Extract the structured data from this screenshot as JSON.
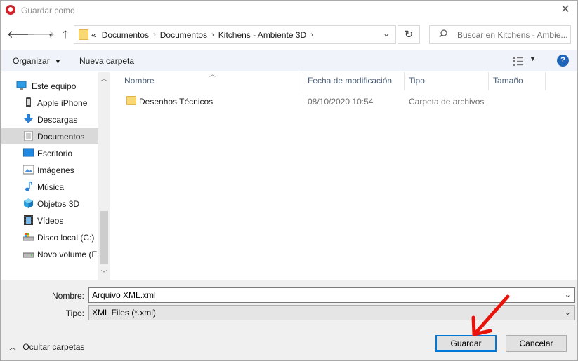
{
  "window": {
    "title": "Guardar como"
  },
  "addressbar": {
    "overflow": "«",
    "crumbs": [
      "Documentos",
      "Documentos",
      "Kitchens - Ambiente 3D"
    ],
    "search_placeholder": "Buscar en Kitchens - Ambie..."
  },
  "toolbar": {
    "organize": "Organizar",
    "new_folder": "Nueva carpeta"
  },
  "nav": {
    "items": [
      {
        "label": "Este equipo",
        "icon": "computer-icon"
      },
      {
        "label": "Apple iPhone",
        "icon": "phone-icon"
      },
      {
        "label": "Descargas",
        "icon": "download-icon"
      },
      {
        "label": "Documentos",
        "icon": "documents-icon",
        "selected": true
      },
      {
        "label": "Escritorio",
        "icon": "desktop-icon"
      },
      {
        "label": "Imágenes",
        "icon": "pictures-icon"
      },
      {
        "label": "Música",
        "icon": "music-icon"
      },
      {
        "label": "Objetos 3D",
        "icon": "3d-objects-icon"
      },
      {
        "label": "Vídeos",
        "icon": "videos-icon"
      },
      {
        "label": "Disco local (C:)",
        "icon": "local-disk-icon"
      },
      {
        "label": "Novo volume (E",
        "icon": "drive-icon"
      }
    ]
  },
  "list": {
    "columns": [
      "Nombre",
      "Fecha de modificación",
      "Tipo",
      "Tamaño"
    ],
    "rows": [
      {
        "name": "Desenhos Técnicos",
        "date": "08/10/2020 10:54",
        "type": "Carpeta de archivos",
        "size": ""
      }
    ]
  },
  "form": {
    "name_label": "Nombre:",
    "name_value": "Arquivo XML.xml",
    "type_label": "Tipo:",
    "type_value": "XML Files (*.xml)"
  },
  "footer": {
    "hide_folders": "Ocultar carpetas",
    "save": "Guardar",
    "cancel": "Cancelar"
  },
  "colors": {
    "accent": "#0078d7",
    "selection": "#d9d9d9",
    "annotation_arrow": "#e8140c"
  }
}
